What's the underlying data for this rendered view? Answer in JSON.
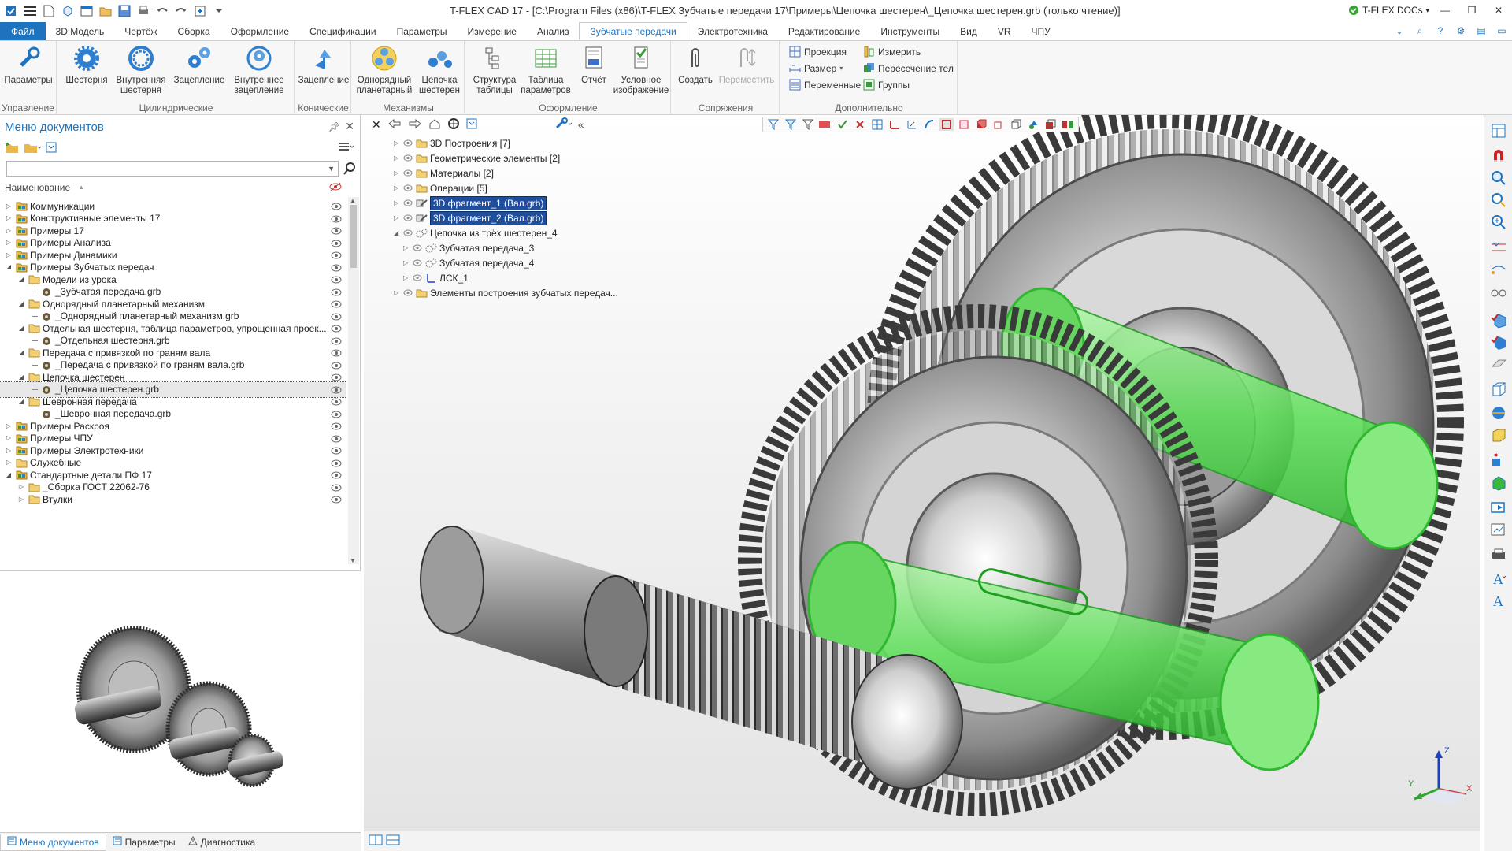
{
  "window": {
    "title": "T-FLEX CAD 17 - [C:\\Program Files (x86)\\T-FLEX Зубчатые передачи 17\\Примеры\\Цепочка шестерен\\_Цепочка шестерен.grb (только чтение)]",
    "docs_label": "T-FLEX DOCs"
  },
  "tabs": [
    "Файл",
    "3D Модель",
    "Чертёж",
    "Сборка",
    "Оформление",
    "Спецификации",
    "Параметры",
    "Измерение",
    "Анализ",
    "Зубчатые передачи",
    "Электротехника",
    "Редактирование",
    "Инструменты",
    "Вид",
    "VR",
    "ЧПУ"
  ],
  "ribbon": {
    "groups": {
      "control": "Управление",
      "cylindrical": "Цилиндрические",
      "conical": "Конические",
      "mechanisms": "Механизмы",
      "formatting": "Оформление",
      "mates": "Сопряжения",
      "extra": "Дополнительно"
    },
    "buttons": {
      "params": "Параметры",
      "gear": "Шестерня",
      "internal_gear_1": "Внутренняя",
      "internal_gear_2": "шестерня",
      "mesh": "Зацепление",
      "internal_mesh_1": "Внутреннее",
      "internal_mesh_2": "зацепление",
      "conical_mesh": "Зацепление",
      "planetary_1": "Однорядный",
      "planetary_2": "планетарный",
      "chain_1": "Цепочка",
      "chain_2": "шестерен",
      "structure_1": "Структура",
      "structure_2": "таблицы",
      "param_table_1": "Таблица",
      "param_table_2": "параметров",
      "report": "Отчёт",
      "cond_image_1": "Условное",
      "cond_image_2": "изображение",
      "create": "Создать",
      "move": "Переместить"
    },
    "small": {
      "projection": "Проекция",
      "size": "Размер",
      "variables": "Переменные",
      "measure": "Измерить",
      "body_intersection": "Пересечение тел",
      "groups": "Группы"
    }
  },
  "left_panel": {
    "title": "Меню документов",
    "search_placeholder": "",
    "column_header": "Наименование",
    "tree": [
      {
        "label": "Коммуникации",
        "level": 0,
        "expanded": false,
        "type": "lib"
      },
      {
        "label": "Конструктивные элементы 17",
        "level": 0,
        "expanded": false,
        "type": "lib"
      },
      {
        "label": "Примеры 17",
        "level": 0,
        "expanded": false,
        "type": "lib"
      },
      {
        "label": "Примеры Анализа",
        "level": 0,
        "expanded": false,
        "type": "lib"
      },
      {
        "label": "Примеры Динамики",
        "level": 0,
        "expanded": false,
        "type": "lib"
      },
      {
        "label": "Примеры Зубчатых передач",
        "level": 0,
        "expanded": true,
        "type": "lib"
      },
      {
        "label": "Модели из урока",
        "level": 1,
        "expanded": true,
        "type": "folder"
      },
      {
        "label": "_Зубчатая передача.grb",
        "level": 2,
        "type": "file"
      },
      {
        "label": "Однорядный планетарный механизм",
        "level": 1,
        "expanded": true,
        "type": "folder"
      },
      {
        "label": "_Однорядный планетарный механизм.grb",
        "level": 2,
        "type": "file"
      },
      {
        "label": "Отдельная шестерня, таблица параметров, упрощенная проек...",
        "level": 1,
        "expanded": true,
        "type": "folder"
      },
      {
        "label": "_Отдельная шестерня.grb",
        "level": 2,
        "type": "file"
      },
      {
        "label": "Передача с привязкой по граням вала",
        "level": 1,
        "expanded": true,
        "type": "folder"
      },
      {
        "label": "_Передача с привязкой по граням вала.grb",
        "level": 2,
        "type": "file"
      },
      {
        "label": "Цепочка шестерен",
        "level": 1,
        "expanded": true,
        "type": "folder"
      },
      {
        "label": "_Цепочка шестерен.grb",
        "level": 2,
        "type": "file",
        "selected": true
      },
      {
        "label": "Шевронная передача",
        "level": 1,
        "expanded": true,
        "type": "folder"
      },
      {
        "label": "_Шевронная передача.grb",
        "level": 2,
        "type": "file"
      },
      {
        "label": "Примеры Раскроя",
        "level": 0,
        "expanded": false,
        "type": "lib"
      },
      {
        "label": "Примеры ЧПУ",
        "level": 0,
        "expanded": false,
        "type": "lib"
      },
      {
        "label": "Примеры Электротехники",
        "level": 0,
        "expanded": false,
        "type": "lib"
      },
      {
        "label": "Служебные",
        "level": 0,
        "expanded": false,
        "type": "folder"
      },
      {
        "label": "Стандартные детали ПФ 17",
        "level": 0,
        "expanded": true,
        "type": "lib"
      },
      {
        "label": "_Сборка ГОСТ 22062-76",
        "level": 1,
        "expanded": false,
        "type": "folder"
      },
      {
        "label": "Втулки",
        "level": 1,
        "expanded": false,
        "type": "folder"
      }
    ],
    "bottom_tabs": [
      "Меню документов",
      "Параметры",
      "Диагностика"
    ]
  },
  "model_tree": [
    {
      "label": "3D Построения [7]",
      "level": 0,
      "type": "folder"
    },
    {
      "label": "Геометрические элементы [2]",
      "level": 0,
      "type": "folder"
    },
    {
      "label": "Материалы [2]",
      "level": 0,
      "type": "folder"
    },
    {
      "label": "Операции [5]",
      "level": 0,
      "type": "folder"
    },
    {
      "label": "3D фрагмент_1 (Вал.grb)",
      "level": 0,
      "type": "frag",
      "highlight": true
    },
    {
      "label": "3D фрагмент_2 (Вал.grb)",
      "level": 0,
      "type": "frag",
      "highlight": true
    },
    {
      "label": "Цепочка из трёх шестерен_4",
      "level": 0,
      "type": "gear",
      "expanded": true
    },
    {
      "label": "Зубчатая передача_3",
      "level": 1,
      "type": "gear"
    },
    {
      "label": "Зубчатая передача_4",
      "level": 1,
      "type": "gear"
    },
    {
      "label": "ЛСК_1",
      "level": 1,
      "type": "lcs"
    },
    {
      "label": "Элементы построения зубчатых передач...",
      "level": 0,
      "type": "folder"
    }
  ],
  "axes": {
    "x": "X",
    "y": "Y",
    "z": "Z"
  },
  "colors": {
    "accent": "#1e73be",
    "selection": "#1f4e9c",
    "highlight_green": "#3ddc3d",
    "folder": "#e8b84a"
  }
}
